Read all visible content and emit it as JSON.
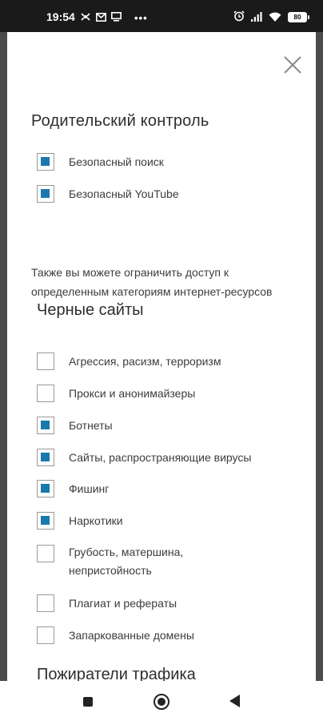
{
  "status_bar": {
    "time": "19:54",
    "battery": "80",
    "left_icons": [
      "broadcast-icon",
      "gmail-icon",
      "monitor-icon",
      "more-dots-icon"
    ],
    "right_icons": [
      "alarm-icon",
      "signal-icon",
      "wifi-icon",
      "battery-icon"
    ]
  },
  "dialog": {
    "title": "Родительский контроль",
    "close_icon": "close-icon",
    "options": [
      {
        "label": "Безопасный поиск",
        "checked": true
      },
      {
        "label": "Безопасный YouTube",
        "checked": true
      }
    ],
    "info_text": "Также вы можете ограничить доступ к определенным категориям интернет-ресурсов",
    "black_sites": {
      "title": "Черные сайты",
      "items": [
        {
          "label": "Агрессия, расизм, терроризм",
          "checked": false
        },
        {
          "label": "Прокси и анонимайзеры",
          "checked": false
        },
        {
          "label": "Ботнеты",
          "checked": true
        },
        {
          "label": "Сайты, распространяющие вирусы",
          "checked": true
        },
        {
          "label": "Фишинг",
          "checked": true
        },
        {
          "label": "Наркотики",
          "checked": true
        },
        {
          "label": "Грубость, матершина, непристойность",
          "checked": false
        },
        {
          "label": "Плагиат и рефераты",
          "checked": false
        },
        {
          "label": "Запаркованные домены",
          "checked": false
        }
      ]
    },
    "traffic_section_title": "Пожиратели трафика"
  },
  "colors": {
    "accent": "#1a78ad",
    "status_bar": "#1a1a1a",
    "dialog_bg": "#ffffff"
  }
}
